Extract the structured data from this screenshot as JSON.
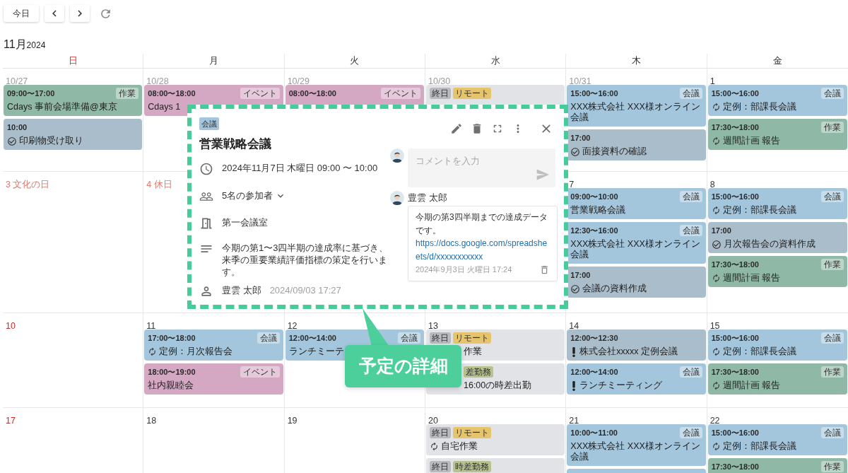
{
  "toolbar": {
    "today_button": "今日"
  },
  "month_title": {
    "month": "11月",
    "year": "2024"
  },
  "weekdays": [
    {
      "label": "日",
      "sunday": true
    },
    {
      "label": "月",
      "sunday": false
    },
    {
      "label": "火",
      "sunday": false
    },
    {
      "label": "水",
      "sunday": false
    },
    {
      "label": "木",
      "sunday": false
    },
    {
      "label": "金",
      "sunday": false
    }
  ],
  "weeks": [
    {
      "days": [
        {
          "date": "10/27",
          "kind": "outside",
          "events": [
            {
              "kind": "work",
              "time": "09:00〜17:00",
              "tag": "作業",
              "title": "Cdays 事前会場準備@東京",
              "recurring": false,
              "important": false
            },
            {
              "kind": "task",
              "time": "10:00",
              "title": "印刷物受け取り",
              "recurring": false,
              "important": false
            }
          ]
        },
        {
          "date": "10/28",
          "kind": "outside",
          "events": [
            {
              "kind": "event",
              "time": "08:00〜18:00",
              "tag": "イベント",
              "title": "Cdays 1",
              "recurring": false,
              "important": false
            }
          ]
        },
        {
          "date": "10/29",
          "kind": "outside",
          "events": [
            {
              "kind": "event",
              "time": "08:00〜18:00",
              "tag": "イベント"
            }
          ]
        },
        {
          "date": "10/30",
          "kind": "outside",
          "events": [
            {
              "kind": "allday",
              "labels": [
                {
                  "text": "終日",
                  "color": "#b8b9be"
                },
                {
                  "text": "リモート",
                  "color": "#e5c46b"
                }
              ]
            }
          ]
        },
        {
          "date": "10/31",
          "kind": "outside",
          "events": [
            {
              "kind": "meeting",
              "time": "15:00〜16:00",
              "tag": "会議",
              "title": "XXX株式会社 XXX様オンライン会議",
              "recurring": false,
              "important": false
            },
            {
              "kind": "task",
              "time": "17:00",
              "title": "面接資料の確認",
              "recurring": false,
              "important": false
            }
          ]
        },
        {
          "date": "1",
          "kind": "normal",
          "events": [
            {
              "kind": "meeting",
              "time": "15:00〜16:00",
              "tag": "会議",
              "title": "定例：部課長会議",
              "recurring": true,
              "important": false
            },
            {
              "kind": "work",
              "time": "17:30〜18:00",
              "tag": "作業",
              "title": "週間計画 報告",
              "recurring": true,
              "important": false
            }
          ]
        }
      ]
    },
    {
      "days": [
        {
          "date": "3 文化の日",
          "kind": "holiday"
        },
        {
          "date": "4 休日",
          "kind": "holiday"
        },
        {
          "date": "7",
          "kind": "normal",
          "events": [
            {
              "kind": "meeting",
              "time": "09:00〜10:00",
              "tag": "会議",
              "title": "営業戦略会議",
              "recurring": false,
              "important": false
            },
            {
              "kind": "meeting",
              "time": "12:30〜16:00",
              "tag": "会議",
              "title": "XXX株式会社 XXX様オンライン会議",
              "recurring": false,
              "important": false
            },
            {
              "kind": "task",
              "time": "17:00",
              "title": "会議の資料作成",
              "recurring": false,
              "important": false
            }
          ]
        },
        {
          "date": "8",
          "kind": "normal",
          "events": [
            {
              "kind": "meeting",
              "time": "15:00〜16:00",
              "tag": "会議",
              "title": "定例：部課長会議",
              "recurring": true,
              "important": false
            },
            {
              "kind": "task",
              "time": "17:00",
              "title": "月次報告会の資料作成",
              "recurring": false,
              "important": false
            },
            {
              "kind": "work",
              "time": "17:30〜18:00",
              "tag": "作業",
              "title": "週間計画 報告",
              "recurring": true,
              "important": false
            }
          ]
        }
      ]
    },
    {
      "days": [
        {
          "date": "10",
          "kind": "sunday"
        },
        {
          "date": "11",
          "kind": "normal",
          "events": [
            {
              "kind": "meeting",
              "time": "17:00〜18:00",
              "tag": "会議",
              "title": "定例：月次報告会",
              "recurring": true,
              "important": false
            },
            {
              "kind": "event",
              "time": "18:00〜19:00",
              "tag": "イベント",
              "title": "社内親睦会",
              "recurring": false,
              "important": false
            }
          ]
        },
        {
          "date": "12",
          "kind": "normal",
          "events": [
            {
              "kind": "meeting",
              "time": "12:00〜14:00",
              "tag": "会議",
              "title": "ランチミーテ",
              "recurring": false,
              "important": false
            }
          ]
        },
        {
          "date": "13",
          "kind": "normal",
          "events": [
            {
              "kind": "allday",
              "labels": [
                {
                  "text": "終日",
                  "color": "#b8b9be"
                },
                {
                  "text": "リモート",
                  "color": "#e5c46b"
                }
              ],
              "title": "作業"
            },
            {
              "kind": "allday",
              "labels": [
                {
                  "text": "差勤務",
                  "color": "#b6c38e"
                }
              ],
              "title": "16:00の時差出勤"
            }
          ]
        },
        {
          "date": "14",
          "kind": "normal",
          "events": [
            {
              "kind": "task",
              "time": "12:00〜12:30",
              "title": "株式会社xxxxx 定例会議",
              "recurring": false,
              "important": true
            },
            {
              "kind": "meeting",
              "time": "12:00〜14:00",
              "tag": "会議",
              "title": "ランチミーティング",
              "recurring": false,
              "important": true
            }
          ]
        },
        {
          "date": "15",
          "kind": "normal",
          "events": [
            {
              "kind": "meeting",
              "time": "15:00〜16:00",
              "tag": "会議",
              "title": "定例：部課長会議",
              "recurring": true,
              "important": false
            },
            {
              "kind": "work",
              "time": "17:30〜18:00",
              "tag": "作業",
              "title": "週間計画 報告",
              "recurring": true,
              "important": false
            }
          ]
        }
      ]
    },
    {
      "days": [
        {
          "date": "17",
          "kind": "sunday"
        },
        {
          "date": "18",
          "kind": "normal"
        },
        {
          "date": "19",
          "kind": "normal"
        },
        {
          "date": "20",
          "kind": "normal",
          "events": [
            {
              "kind": "allday",
              "labels": [
                {
                  "text": "終日",
                  "color": "#b8b9be"
                },
                {
                  "text": "リモート",
                  "color": "#e5c46b"
                }
              ],
              "title": "自宅作業",
              "recurring": true,
              "important": false
            },
            {
              "kind": "allday",
              "labels": [
                {
                  "text": "終日",
                  "color": "#b8b9be"
                },
                {
                  "text": "時差勤務",
                  "color": "#b6c38e"
                }
              ]
            }
          ]
        },
        {
          "date": "21",
          "kind": "normal",
          "events": [
            {
              "kind": "meeting",
              "time": "10:00〜11:00",
              "tag": "会議",
              "title": "XXX株式会社 XXX様オンライン会議",
              "recurring": false,
              "important": false
            },
            {
              "kind": "meeting"
            }
          ]
        },
        {
          "date": "22",
          "kind": "normal",
          "events": [
            {
              "kind": "meeting",
              "time": "15:00〜16:00",
              "tag": "会議",
              "title": "定例：部課長会議",
              "recurring": true,
              "important": false
            },
            {
              "kind": "work",
              "time": "17:30〜18:00",
              "tag": "作業"
            }
          ]
        }
      ]
    }
  ],
  "popup": {
    "category": "会議",
    "title": "営業戦略会議",
    "details": [
      {
        "kind": "time",
        "text": "2024年11月7日 木曜日 09:00 〜 10:00"
      },
      {
        "kind": "attendees",
        "text": "5名の参加者",
        "expanded": false
      },
      {
        "kind": "room",
        "text": "第一会議室"
      },
      {
        "kind": "description",
        "text": "今期の第1〜3四半期の達成率に基づき、来季の重要業績評価指標の策定を行います。"
      },
      {
        "kind": "creator",
        "text": "豊雲 太郎",
        "meta": "2024/09/03 17:27"
      }
    ],
    "comment_field": {
      "placeholder": "コメントを入力"
    },
    "comments": [
      {
        "author": "豊雲 太郎",
        "text": "今期の第3四半期までの達成データです。",
        "link": "https://docs.google.com/spreadsheets/d/xxxxxxxxxxx",
        "time": "2024年9月3日 火曜日 17:24"
      }
    ]
  },
  "callout": {
    "text": "予定の詳細"
  }
}
